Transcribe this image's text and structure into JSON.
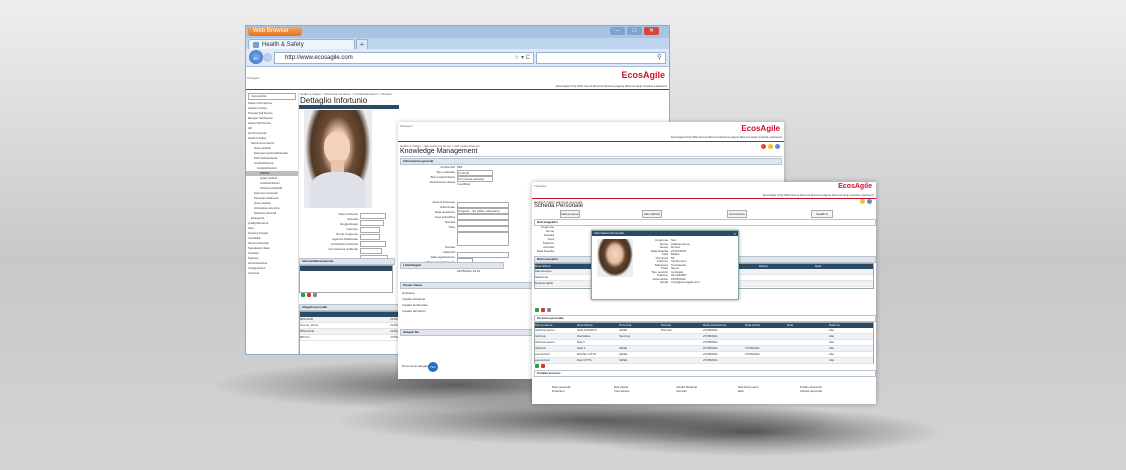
{
  "browser": {
    "brand_button": "Web Browser",
    "tab_title": "Health & Safety",
    "url": "http://www.ecosagile.com",
    "window_controls": [
      "–",
      "□",
      "✕"
    ]
  },
  "app": {
    "logo": "EcosAgile",
    "brand_color": "#d0102a",
    "header_color": "#2d4a63"
  },
  "win1": {
    "crumb": "Health & Safety > Sicurezza sul lavoro > Incidenti/Infortuni > Infortuni",
    "title": "Dettaglio Infortunio",
    "top_menu": "EcosAgile   FAQ   Wiki   Nuova Ricerca   Ricerca pagina   Ricerca   Help   Cambia password",
    "side_search": "Cerca attività",
    "side_items": [
      "Sistemi informazione",
      "Gestione risorse",
      "Processi Self Service",
      "Manager Self Service",
      "Sistemi Self Service",
      "HR",
      "Servizi Generali",
      "Health & Safety",
      "Sicurezza sul lavoro",
      "Visite mediche",
      "Documenti personali/Idoneità",
      "DVR rischi/ambiente",
      "Incidenti/Infortuni",
      "Incidenti/Infortuni",
      "Infortuni",
      "Quasi incidenti",
      "Incidenti/infortuni",
      "Incidenti ambientali",
      "Documenti personali",
      "Permessi/ trattamenti",
      "Visite mediche",
      "Formazione sicurezza",
      "Dotazioni personali",
      "Emergenze",
      "Quality/Sicurezza",
      "Gare",
      "Gestione Progetti",
      "Contabilità",
      "Servizi Ambientali",
      "Segnalazioni Stato",
      "Operatori",
      "Supporto",
      "Amministrazione",
      "Configurazione",
      "Contenuti"
    ],
    "fields": [
      "Data infortunio",
      "Azienda",
      "Gruppo/luogo",
      "Comune",
      "Nome Cognome",
      "Agenzia /Nazionale",
      "Condizioni infortunio",
      "Conoscenza incidente"
    ],
    "section": "Infortuni/Dicastaccate",
    "attachments": "Allegati personali",
    "attach_rows": [
      "RPH4A/B",
      "Grome_Rtm1",
      "RPHA4r4s",
      "RPLS.t"
    ],
    "attach_dates": [
      "21/05/2011",
      "21/05/2011",
      "21/06/2011",
      "17/05/2011"
    ]
  },
  "win2": {
    "top_menu": "EcosAgile  FAQ  Wiki  Nuova Ricerca  Ricerca pagina  Ricerca  Help  Cambia password",
    "crumb": "Health & Safety > Sicurezza sul lavoro > KM multicontenuto",
    "title": "Knowledge Management",
    "section_info": "Informazioni generali",
    "fields": [
      "Codice KM",
      "Tipo materiale",
      "Breve Descrizione",
      "Descrizione estesa",
      "Area di interesse",
      "Autorizzato",
      "Data creazione",
      "Area scientifica",
      "Società",
      "Note",
      "Società",
      "Data KM",
      "Data registrazione",
      "Ultimo aggiornamento"
    ],
    "values": [
      "658",
      "Controlli",
      "Km ricerca accesso",
      "(modifica)",
      "",
      "Progetto... Ex Office, Monsanto",
      "",
      "",
      "",
      "",
      "",
      "",
      "23/05/2011 22:15",
      "23/05/2011 19:43"
    ],
    "section_links": "Link/Allegati",
    "section_parole": "Parole chiave",
    "keywords": [
      "Ambiente",
      "Impatto Ambiente",
      "Impatto ambientale",
      "Impatto del lavoro"
    ],
    "section_alleg": "Allegati file",
    "footer_label": "Documento allegato",
    "badge": "ISO"
  },
  "win3": {
    "top_menu": "EcosAgile  FAQ  Wiki  Nuova Ricerca  Ricerca pagina  Ricerca  Help  Cambia password",
    "crumb": "Health & Safety > Scheda personale",
    "title": "Scheda Personale",
    "buttons": [
      "Dati persona",
      "Altri Indirizzi",
      "Formazione",
      "Health & Safety"
    ],
    "section_dati": "Dati anagrafici",
    "section_dati2": "Dati Lavorativi",
    "fields": [
      "Cognome",
      "Nome",
      "Societa",
      "Area",
      "Telefono",
      "Azienda",
      "Data Nascita"
    ],
    "popup_title": "Informazioni Personali",
    "popup_fields": [
      [
        "Cognome",
        "Sun"
      ],
      [
        "Nome",
        "Clarissa Anna"
      ],
      [
        "Sesso",
        "Donna"
      ],
      [
        "Data Nascita",
        "27/04/1978"
      ],
      [
        "Città",
        "Milano"
      ],
      [
        "Provincia",
        "MI"
      ],
      [
        "Indirizzo",
        "Via Roma 1"
      ],
      [
        "Mansione",
        "Consulente"
      ],
      [
        "Titolo",
        "Sig.ra"
      ],
      [
        "Tipo servizio",
        "Contratto"
      ],
      [
        "Telefono",
        "02 1234567"
      ],
      [
        "Assunzione",
        "16/05/2011"
      ],
      [
        "Email",
        "csun@ecosagile.com"
      ]
    ],
    "table_headers": [
      "Descrizione",
      "Provincia",
      "Data Inizio",
      "Data Fine",
      "Motivo",
      "Note"
    ],
    "table_rows": [
      [
        "Manutentore",
        "Valente Elettronico",
        "21/03/2011",
        "Normale"
      ],
      [
        "Selezione",
        "Sole",
        "21/03/2011",
        "Ferma"
      ],
      [
        "Responsabile",
        "",
        "17/01/2011",
        ""
      ]
    ],
    "section_pers": "Persona personale",
    "pers_headers": [
      "Tipo persona",
      "Descrizione",
      "Provincia",
      "Periodo",
      "Data prescrizione",
      "Data di fine",
      "Note",
      "Data tra"
    ],
    "pers_rows": [
      [
        "rischiosi lavoro",
        "Sedi ANTER S.",
        "CESE",
        "Pericolo",
        "27/08/2011",
        "",
        "",
        "Alto"
      ],
      [
        "rischiosi",
        "Dati Elites",
        "Sportiva",
        "",
        "27/08/2011",
        "",
        "",
        "Alto"
      ],
      [
        "rischiosi lavoro",
        "Dati T",
        "",
        "",
        "27/08/2011",
        "",
        "",
        "Alto"
      ],
      [
        "rischiosi",
        "Sedi 1",
        "CESE",
        "",
        "27/08/2011",
        "27/08/2011",
        "",
        "Alto"
      ],
      [
        "esposizioni",
        "Rischio CITTA",
        "CESE",
        "",
        "27/08/2011",
        "27/08/2011",
        "",
        "Alto"
      ],
      [
        "esposizioni",
        "Dati CITTA",
        "CESE",
        "",
        "27/08/2011",
        "",
        "",
        "Alto"
      ]
    ],
    "section_conv": "Cambia accesso",
    "footer_links": [
      "Dati personali",
      "Dati infanti",
      "Attività Mediche",
      "Dati Documenti",
      "Profilo sicurezza",
      "Dotazioni",
      "Formazione",
      "Infortuni",
      "Esiti",
      "Attività personali"
    ]
  }
}
